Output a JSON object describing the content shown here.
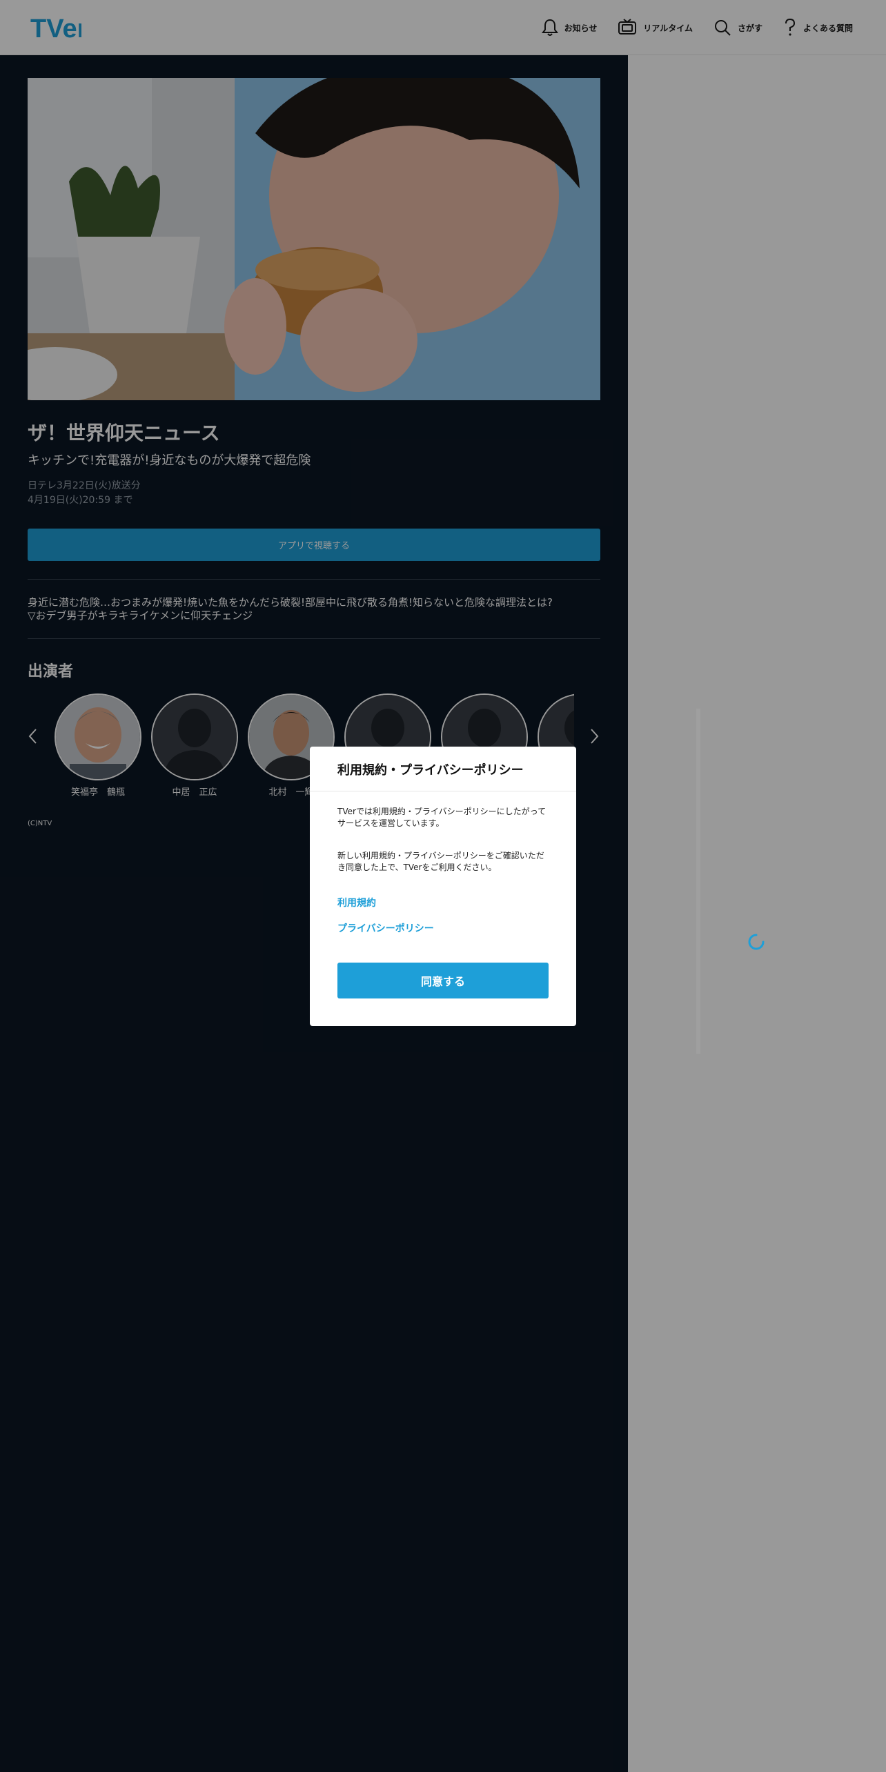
{
  "header": {
    "logo_text": "TVer",
    "nav": [
      {
        "label": "お知らせ",
        "icon": "bell-icon"
      },
      {
        "label": "リアルタイム",
        "icon": "tv-icon"
      },
      {
        "label": "さがす",
        "icon": "search-icon"
      },
      {
        "label": "よくある質問",
        "icon": "question-icon"
      }
    ]
  },
  "episode": {
    "title": "ザ！世界仰天ニュース",
    "subtitle": "キッチンで!充電器が!身近なものが大爆発で超危険",
    "broadcast": "日テレ3月22日(火)放送分",
    "expiry": "4月19日(火)20:59 まで",
    "watch_button": "アプリで視聴する",
    "description": [
      "身近に潜む危険…おつまみが爆発!焼いた魚をかんだら破裂!部屋中に飛び散る角煮!知らないと危険な調理法とは?",
      "▽おデブ男子がキラキライケメンに仰天チェンジ"
    ]
  },
  "cast": {
    "heading": "出演者",
    "members": [
      {
        "name": "笑福亭　鶴瓶",
        "photo": "portrait"
      },
      {
        "name": "中居　正広",
        "photo": "placeholder"
      },
      {
        "name": "北村　一輝",
        "photo": "portrait"
      },
      {
        "name": "",
        "photo": "placeholder"
      },
      {
        "name": "",
        "photo": "placeholder"
      },
      {
        "name": "",
        "photo": "placeholder"
      }
    ]
  },
  "copyright": "(C)NTV",
  "modal": {
    "title": "利用規約・プライバシーポリシー",
    "text1": "TVerでは利用規約・プライバシーポリシーにしたがってサービスを運営しています。",
    "text2": "新しい利用規約・プライバシーポリシーをご確認いただき同意した上で、TVerをご利用ください。",
    "link_terms": "利用規約",
    "link_privacy": "プライバシーポリシー",
    "agree_button": "同意する"
  },
  "colors": {
    "accent": "#1e9fd8",
    "dark_bg": "#0b1623",
    "logo_blue": "#1e9fd8",
    "logo_dark": "#1a3e66"
  }
}
